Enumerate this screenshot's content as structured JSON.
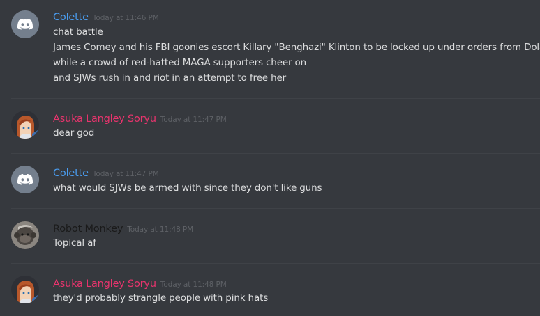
{
  "colors": {
    "background": "#36393e",
    "divider": "#3f4247",
    "text": "#dcddde",
    "timestamp": "#5e6166",
    "colette_name": "#4a9df0",
    "asuka_name": "#e8346d",
    "robot_name": "#1a1a1a"
  },
  "messages": [
    {
      "author": "Colette",
      "timestamp": "Today at 11:46 PM",
      "avatar": "discord-default-icon",
      "lines": [
        "chat battle",
        "James Comey and his FBI goonies escort Killary \"Benghazi\" Klinton to be locked up under orders from Dolan",
        "while a crowd of red-hatted MAGA supporters cheer on",
        "and SJWs rush in and riot in an attempt to free her"
      ]
    },
    {
      "author": "Asuka Langley Soryu",
      "timestamp": "Today at 11:47 PM",
      "avatar": "anime-avatar",
      "lines": [
        "dear god"
      ]
    },
    {
      "author": "Colette",
      "timestamp": "Today at 11:47 PM",
      "avatar": "discord-default-icon",
      "lines": [
        "what would SJWs be armed with since they don't like guns"
      ]
    },
    {
      "author": "Robot Monkey",
      "timestamp": "Today at 11:48 PM",
      "avatar": "monkey-avatar",
      "lines": [
        "Topical af"
      ]
    },
    {
      "author": "Asuka Langley Soryu",
      "timestamp": "Today at 11:48 PM",
      "avatar": "anime-avatar",
      "lines": [
        "they'd probably strangle people with pink hats"
      ]
    }
  ]
}
